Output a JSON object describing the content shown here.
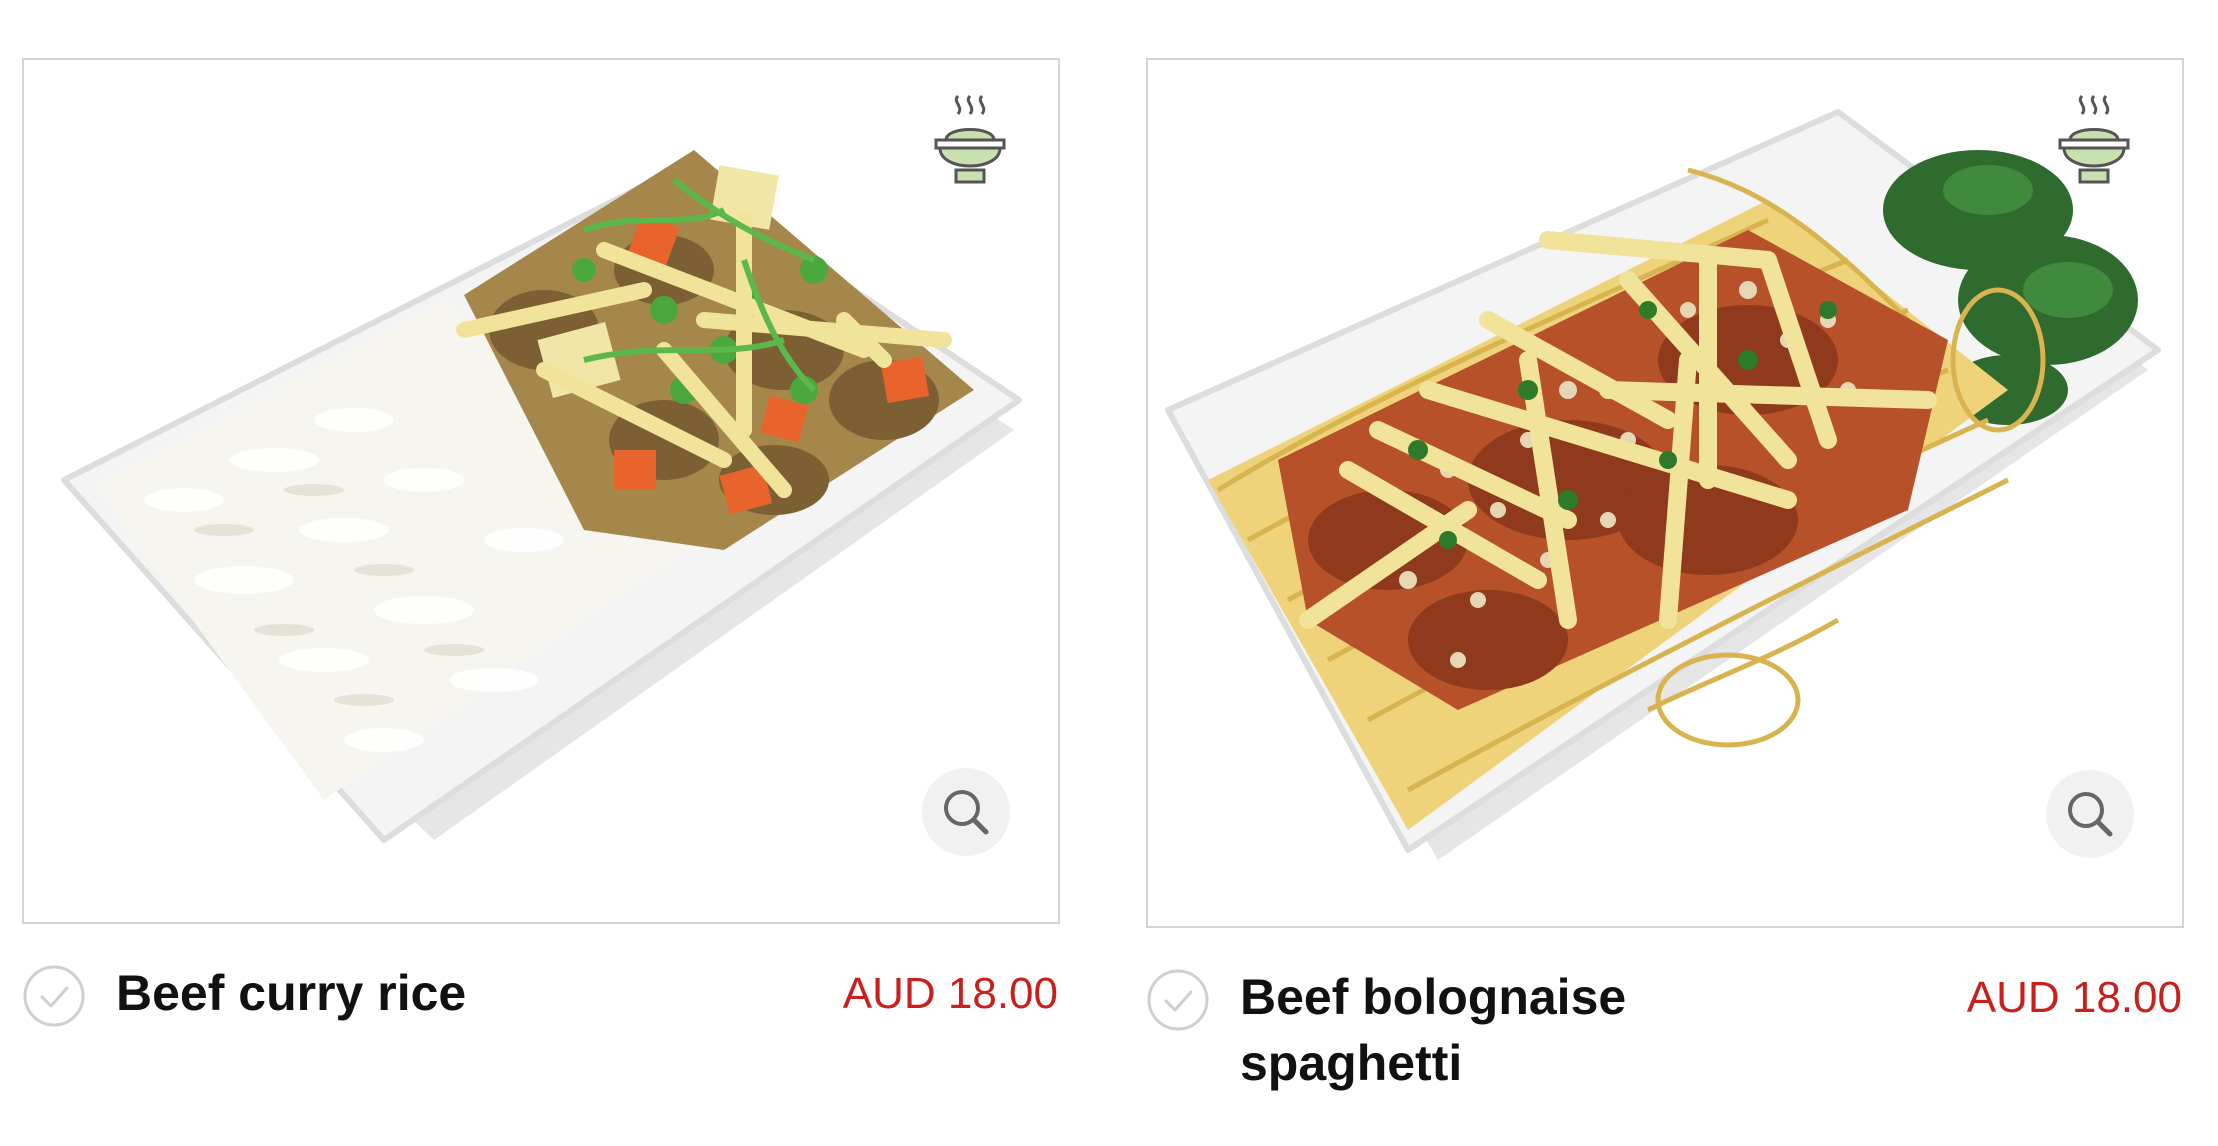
{
  "colors": {
    "price": "#c8201c",
    "icon_green": "#c9e0b0",
    "icon_stroke": "#555555",
    "frame_border": "#d4d4d4"
  },
  "items": [
    {
      "name": "Beef curry rice",
      "price": "AUD 18.00",
      "icons": [
        "hot-meal-bowl-icon",
        "zoom-magnifier-icon",
        "select-checkmark-icon"
      ]
    },
    {
      "name": "Beef bolognaise spaghetti",
      "price": "AUD 18.00",
      "icons": [
        "hot-meal-bowl-icon",
        "zoom-magnifier-icon",
        "select-checkmark-icon"
      ]
    }
  ]
}
